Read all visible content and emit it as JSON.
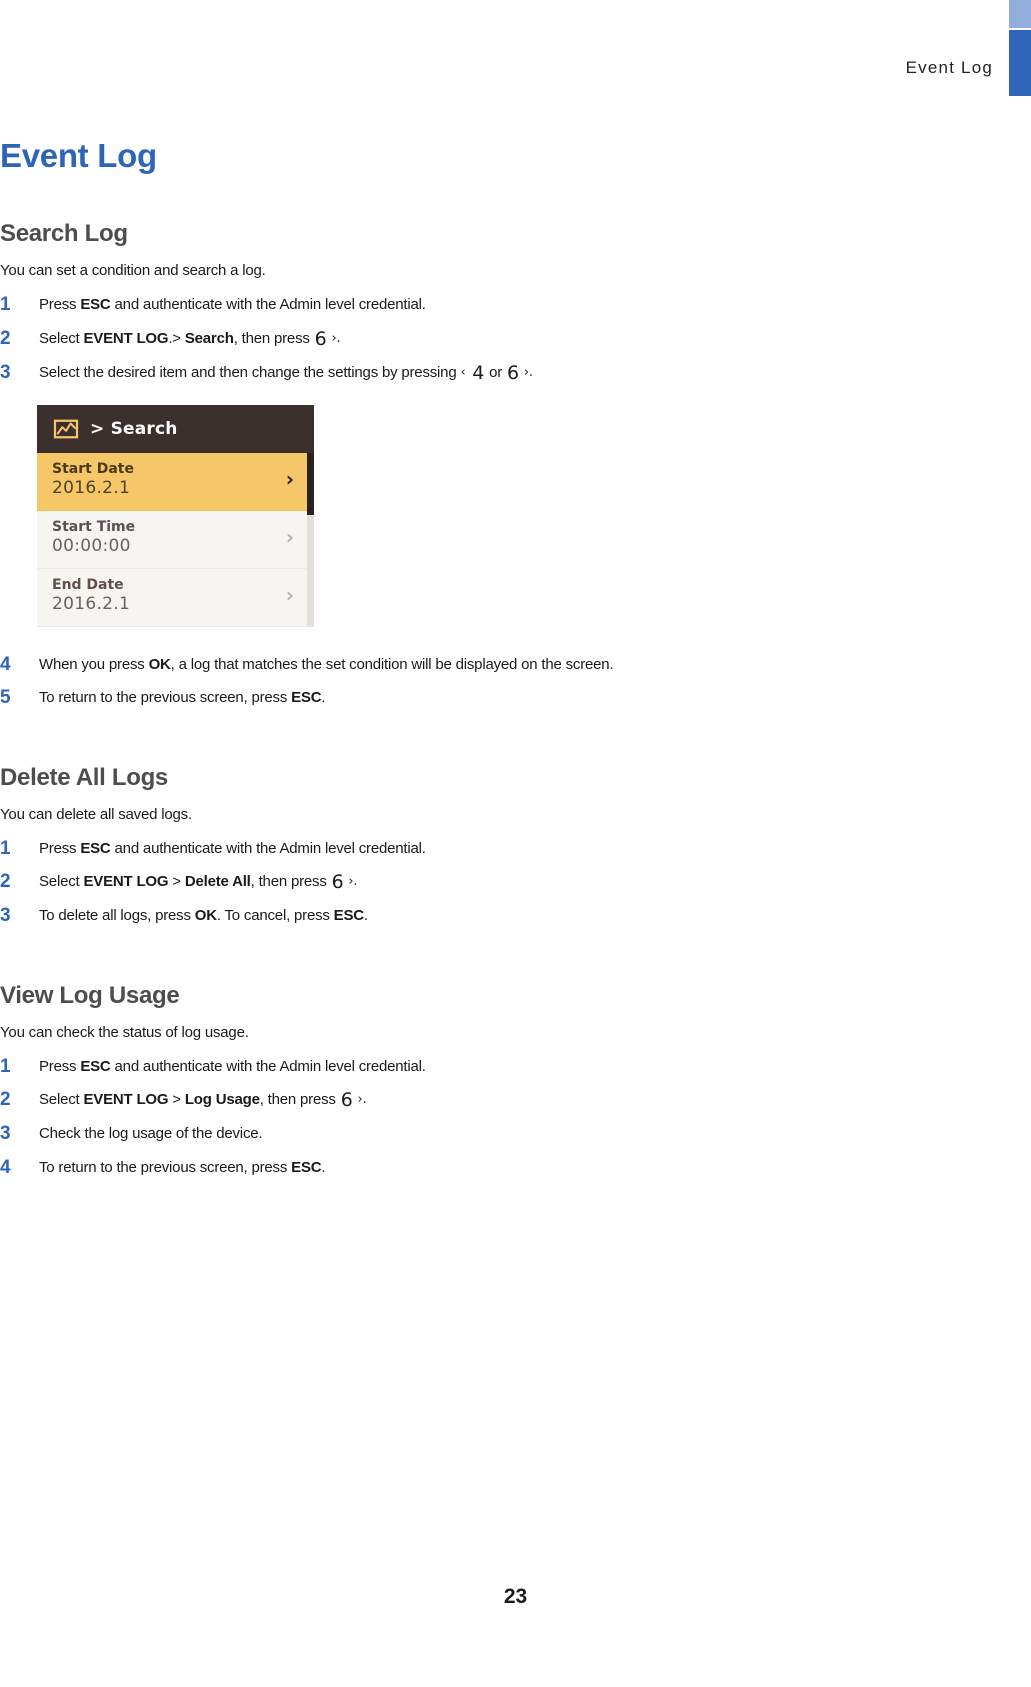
{
  "header": {
    "running_head": "Event  Log",
    "tab_light_color": "#93AEDC",
    "tab_dark_color": "#2E65B8"
  },
  "chapter": {
    "title": "Event Log",
    "title_color": "#2E65B8"
  },
  "sections": [
    {
      "id": "search-log",
      "title": "Search Log",
      "intro": "You can set a condition and search a log.",
      "steps": [
        {
          "num": "1",
          "parts": [
            {
              "t": "Press ",
              "b": false
            },
            {
              "t": "ESC",
              "b": true
            },
            {
              "t": " and authenticate with the Admin level credential.",
              "b": false
            }
          ]
        },
        {
          "num": "2",
          "parts": [
            {
              "t": "Select ",
              "b": false
            },
            {
              "t": "EVENT LOG",
              "b": true
            },
            {
              "t": ".> ",
              "b": false
            },
            {
              "t": "Search",
              "b": true
            },
            {
              "t": ", then press ",
              "b": false
            },
            {
              "t": "6",
              "b": false,
              "glyph": true
            },
            {
              "t": " ›.",
              "b": false,
              "arrow": true
            }
          ]
        },
        {
          "num": "3",
          "parts": [
            {
              "t": "Select the desired item and then change the settings by pressing ",
              "b": false
            },
            {
              "t": "‹",
              "b": false,
              "arrow": true
            },
            {
              "t": " 4",
              "b": false,
              "glyph": true
            },
            {
              "t": " or ",
              "b": false
            },
            {
              "t": "6",
              "b": false,
              "glyph": true
            },
            {
              "t": " ›.",
              "b": false,
              "arrow": true
            }
          ]
        },
        {
          "num": "4",
          "parts": [
            {
              "t": "When you press ",
              "b": false
            },
            {
              "t": "OK",
              "b": true
            },
            {
              "t": ", a log that matches the set condition will be displayed on the screen.",
              "b": false
            }
          ]
        },
        {
          "num": "5",
          "parts": [
            {
              "t": "To return to the previous screen, press ",
              "b": false
            },
            {
              "t": "ESC",
              "b": true
            },
            {
              "t": ".",
              "b": false
            }
          ]
        }
      ]
    },
    {
      "id": "delete-all-logs",
      "title": "Delete All Logs",
      "intro": "You can delete all saved logs.",
      "steps": [
        {
          "num": "1",
          "parts": [
            {
              "t": "Press ",
              "b": false
            },
            {
              "t": "ESC",
              "b": true
            },
            {
              "t": " and authenticate with the Admin level credential.",
              "b": false
            }
          ]
        },
        {
          "num": "2",
          "parts": [
            {
              "t": "Select ",
              "b": false
            },
            {
              "t": "EVENT LOG",
              "b": true
            },
            {
              "t": " > ",
              "b": false
            },
            {
              "t": "Delete All",
              "b": true
            },
            {
              "t": ", then press ",
              "b": false
            },
            {
              "t": "6",
              "b": false,
              "glyph": true
            },
            {
              "t": " ›.",
              "b": false,
              "arrow": true
            }
          ]
        },
        {
          "num": "3",
          "parts": [
            {
              "t": "To delete all logs, press ",
              "b": false
            },
            {
              "t": "OK",
              "b": true
            },
            {
              "t": ". To cancel, press ",
              "b": false
            },
            {
              "t": "ESC",
              "b": true
            },
            {
              "t": ".",
              "b": false
            }
          ]
        }
      ]
    },
    {
      "id": "view-log-usage",
      "title": "View Log Usage",
      "intro": "You can check the status of log usage.",
      "steps": [
        {
          "num": "1",
          "parts": [
            {
              "t": "Press ",
              "b": false
            },
            {
              "t": "ESC",
              "b": true
            },
            {
              "t": " and authenticate with the Admin level credential.",
              "b": false
            }
          ]
        },
        {
          "num": "2",
          "parts": [
            {
              "t": "Select ",
              "b": false
            },
            {
              "t": "EVENT LOG",
              "b": true
            },
            {
              "t": " > ",
              "b": false
            },
            {
              "t": "Log Usage",
              "b": true
            },
            {
              "t": ", then press ",
              "b": false
            },
            {
              "t": "6",
              "b": false,
              "glyph": true
            },
            {
              "t": " ›.",
              "b": false,
              "arrow": true
            }
          ]
        },
        {
          "num": "3",
          "parts": [
            {
              "t": "Check the log usage of the device.",
              "b": false
            }
          ]
        },
        {
          "num": "4",
          "parts": [
            {
              "t": "To return to the previous screen, press ",
              "b": false
            },
            {
              "t": "ESC",
              "b": true
            },
            {
              "t": ".",
              "b": false
            }
          ]
        }
      ]
    }
  ],
  "device_screenshot": {
    "icon": "log-chart-icon",
    "titlebar_text": "> Search",
    "titlebar_color": "#3b302d",
    "highlight_color": "#f5c768",
    "rows": [
      {
        "label": "Start Date",
        "value": "2016.2.1",
        "selected": true,
        "chevron": "›"
      },
      {
        "label": "Start Time",
        "value": "00:00:00",
        "selected": false,
        "chevron": "›"
      },
      {
        "label": "End Date",
        "value": "2016.2.1",
        "selected": false,
        "chevron": "›"
      }
    ]
  },
  "footer": {
    "page_number": "23"
  }
}
